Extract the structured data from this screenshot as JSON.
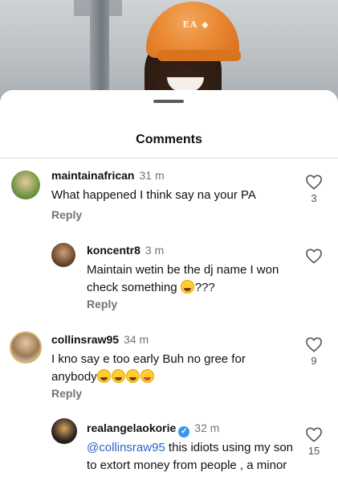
{
  "sheet": {
    "title": "Comments"
  },
  "comments": [
    {
      "username": "maintainafrican",
      "time": "31 m",
      "text": "What happened I think say na your PA",
      "reply_label": "Reply",
      "likes": "3",
      "avatar_color": "#4f7a3a"
    },
    {
      "username": "koncentr8",
      "time": "3 m",
      "text_before": "Maintain wetin be the dj name I won check something ",
      "text_after": "???",
      "reply_label": "Reply",
      "likes": "",
      "avatar_color": "#6b4a2f"
    },
    {
      "username": "collinsraw95",
      "time": "34 m",
      "text": "I kno say e too early Buh no gree for anybody",
      "reply_label": "Reply",
      "likes": "9",
      "avatar_color": "#c29540"
    },
    {
      "username": "realangelaokorie",
      "time": "32 m",
      "mention": "@collinsraw95",
      "text": " this idiots using my son  to extort money from people , a minor",
      "likes": "15",
      "avatar_color": "#2c2320"
    }
  ],
  "colors": {
    "mention": "#2e63c6",
    "verified": "#3897f0",
    "muted": "#737373"
  },
  "icons": [
    "heart-outline-icon",
    "verified-badge-icon",
    "laughing-emoji-icon",
    "tongue-emoji-icon"
  ]
}
